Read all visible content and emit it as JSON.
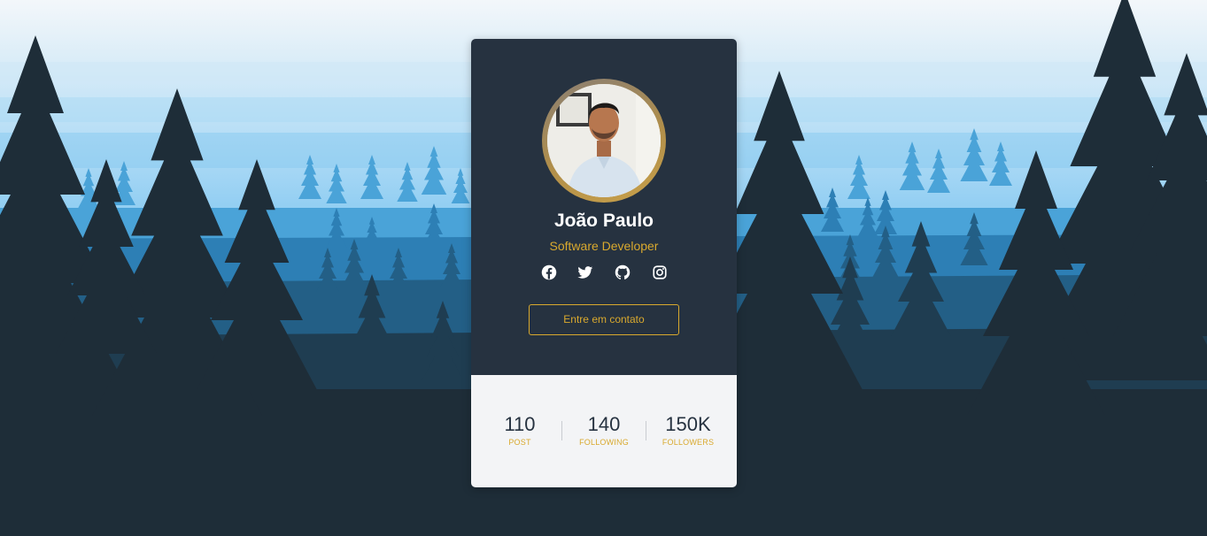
{
  "profile": {
    "name": "João Paulo",
    "role": "Software Developer",
    "contact_label": "Entre em contato"
  },
  "socials": [
    {
      "icon": "facebook-icon"
    },
    {
      "icon": "twitter-icon"
    },
    {
      "icon": "github-icon"
    },
    {
      "icon": "instagram-icon"
    }
  ],
  "stats": [
    {
      "value": "110",
      "label": "POST"
    },
    {
      "value": "140",
      "label": "FOLLOWING"
    },
    {
      "value": "150K",
      "label": "FOLLOWERS"
    }
  ],
  "colors": {
    "card_dark": "#263240",
    "accent": "#d9a92e",
    "card_light": "#f3f4f6"
  }
}
